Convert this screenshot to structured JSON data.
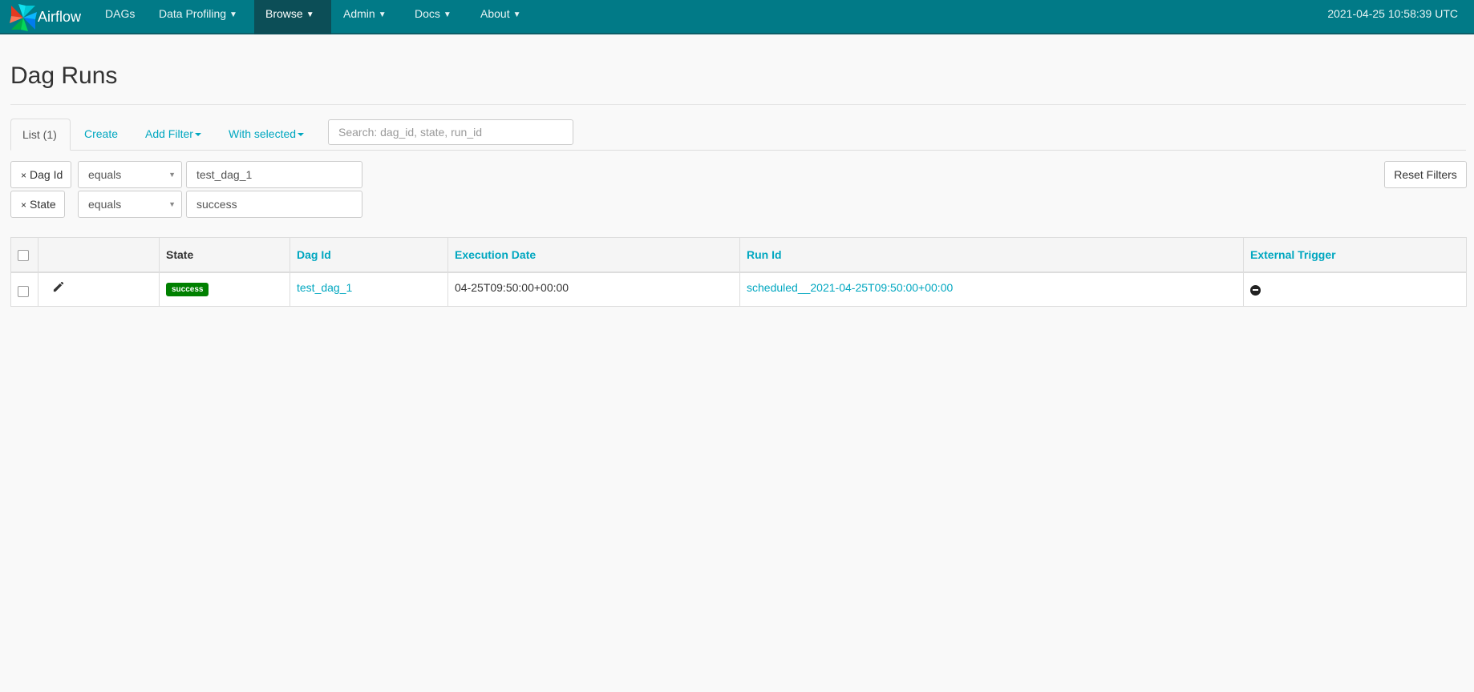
{
  "navbar": {
    "brand": "Airflow",
    "items": [
      {
        "label": "DAGs"
      },
      {
        "label": "Data Profiling"
      },
      {
        "label": "Browse"
      },
      {
        "label": "Admin"
      },
      {
        "label": "Docs"
      },
      {
        "label": "About"
      }
    ],
    "time": "2021-04-25 10:58:39 UTC",
    "colors": {
      "bar": "#017a87",
      "active": "#0c4e57"
    }
  },
  "page": {
    "title": "Dag Runs"
  },
  "tabs": {
    "list": "List (1)",
    "create": "Create",
    "add_filter": "Add Filter",
    "with_selected": "With selected"
  },
  "search": {
    "placeholder": "Search: dag_id, state, run_id"
  },
  "filters": [
    {
      "field": "Dag Id",
      "operator": "equals",
      "value": "test_dag_1"
    },
    {
      "field": "State",
      "operator": "equals",
      "value": "success"
    }
  ],
  "reset_filters": "Reset Filters",
  "table": {
    "headers": {
      "state": "State",
      "dag_id": "Dag Id",
      "execution_date": "Execution Date",
      "run_id": "Run Id",
      "external_trigger": "External Trigger"
    },
    "rows": [
      {
        "state": "success",
        "dag_id": "test_dag_1",
        "execution_date": "04-25T09:50:00+00:00",
        "run_id": "scheduled__2021-04-25T09:50:00+00:00",
        "external_trigger_icon": "minus-circle-icon"
      }
    ]
  },
  "colors": {
    "link": "#00a7c0",
    "success": "#008000"
  }
}
